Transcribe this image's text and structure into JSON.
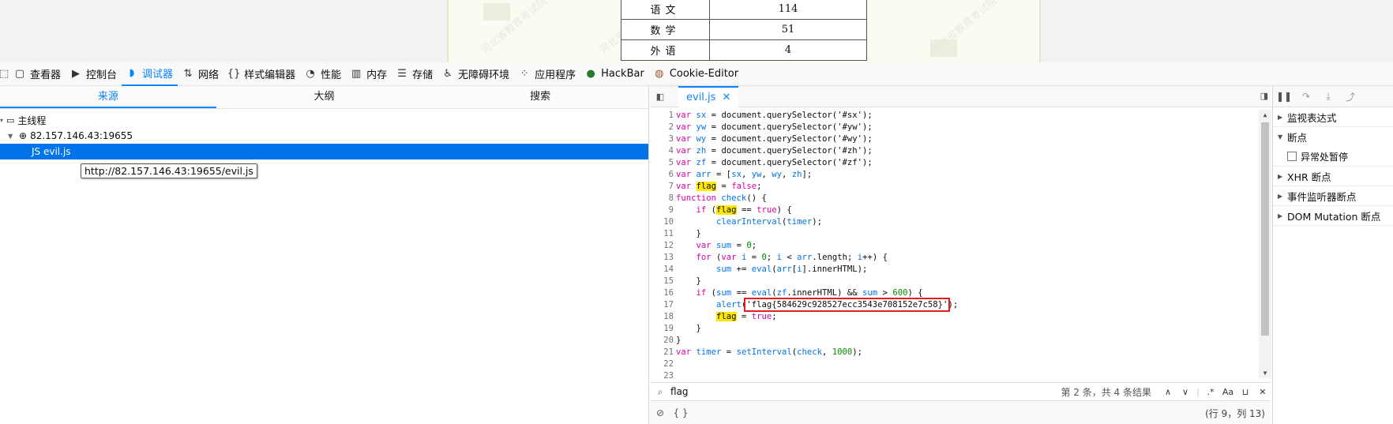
{
  "webpage": {
    "watermark": "河北省教育考试院",
    "scores": [
      {
        "subject": "语文",
        "score": "114"
      },
      {
        "subject": "数学",
        "score": "51"
      },
      {
        "subject": "外语",
        "score": "4"
      }
    ]
  },
  "toolbar": {
    "tabs": [
      {
        "icon": "inspector-icon",
        "glyph": "▢",
        "label": "查看器"
      },
      {
        "icon": "console-icon",
        "glyph": "▶",
        "label": "控制台"
      },
      {
        "icon": "debugger-icon",
        "glyph": "◗",
        "label": "调试器"
      },
      {
        "icon": "network-icon",
        "glyph": "⇅",
        "label": "网络"
      },
      {
        "icon": "style-editor-icon",
        "glyph": "{}",
        "label": "样式编辑器"
      },
      {
        "icon": "performance-icon",
        "glyph": "◔",
        "label": "性能"
      },
      {
        "icon": "memory-icon",
        "glyph": "▥",
        "label": "内存"
      },
      {
        "icon": "storage-icon",
        "glyph": "☰",
        "label": "存储"
      },
      {
        "icon": "accessibility-icon",
        "glyph": "♿",
        "label": "无障碍环境"
      },
      {
        "icon": "application-icon",
        "glyph": "⁘",
        "label": "应用程序"
      },
      {
        "icon": "hackbar-icon",
        "glyph": "●",
        "label": "HackBar"
      },
      {
        "icon": "cookie-editor-icon",
        "glyph": "◍",
        "label": "Cookie-Editor"
      }
    ]
  },
  "sources": {
    "tabs": [
      "来源",
      "大纲",
      "搜索"
    ],
    "main_thread": "主线程",
    "host": "82.157.146.43:19655",
    "file": "JS  evil.js",
    "tooltip": "http://82.157.146.43:19655/evil.js"
  },
  "editor": {
    "file_tab": "evil.js",
    "search_value": "flag",
    "search_count": "第 2 条，共 4 条结果",
    "search_regex": ".*",
    "search_case": "Aa",
    "cursor_pos": "(行 9，列 13)",
    "braces": "{ }",
    "code": {
      "l1_v": "sx",
      "l1_s": "'#sx'",
      "l2_v": "yw",
      "l2_s": "'#yw'",
      "l3_v": "wy",
      "l3_s": "'#wy'",
      "l4_v": "zh",
      "l4_s": "'#zh'",
      "l5_v": "zf",
      "l5_s": "'#zf'",
      "qs": "document.querySelector",
      "alert_str": "'flag{584629c928527ecc3543e708152e7c58}'"
    }
  },
  "right_panel": {
    "watch": "监视表达式",
    "breakpoints": "断点",
    "pause_on_exceptions": "异常处暂停",
    "xhr": "XHR 断点",
    "event_listeners": "事件监听器断点",
    "dom_mutation": "DOM Mutation 断点"
  }
}
